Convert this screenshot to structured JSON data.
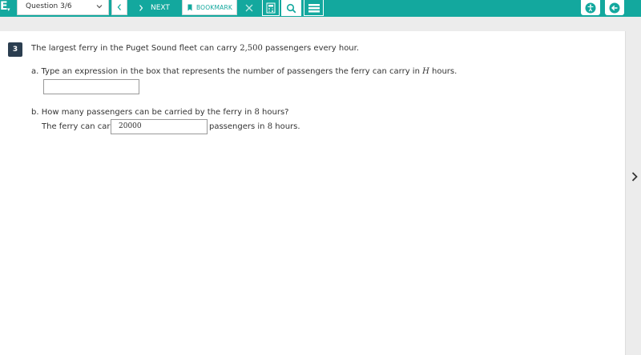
{
  "toolbar": {
    "brand": "E",
    "question_select": "Question 3/6",
    "next_label": "NEXT",
    "bookmark_label": "BOOKMARK"
  },
  "question": {
    "number": "3",
    "stem_prefix": "The largest ferry in the Puget Sound fleet can carry ",
    "stem_number": "2,500",
    "stem_suffix": " passengers every hour.",
    "part_a": {
      "prefix": "a.  Type an expression in the box that represents the number of passengers the ferry can carry in ",
      "variable": "H",
      "suffix": " hours.",
      "answer_value": ""
    },
    "part_b": {
      "prefix": "b.  How many passengers can be carried by the ferry in ",
      "number": "8",
      "suffix": " hours?",
      "sentence_before": "The ferry can carry",
      "answer_value": "20000",
      "sentence_after_prefix": "passengers in ",
      "sentence_after_number": "8",
      "sentence_after_suffix": " hours."
    }
  },
  "colors": {
    "accent": "#13a89e",
    "question_badge": "#2b3e50"
  },
  "icons": [
    "chevron-down-icon",
    "chevron-left-icon",
    "chevron-right-icon",
    "bookmark-icon",
    "close-icon",
    "calculator-icon",
    "search-icon",
    "menu-icon",
    "accessibility-icon",
    "back-arrow-icon",
    "next-page-arrow-icon"
  ]
}
